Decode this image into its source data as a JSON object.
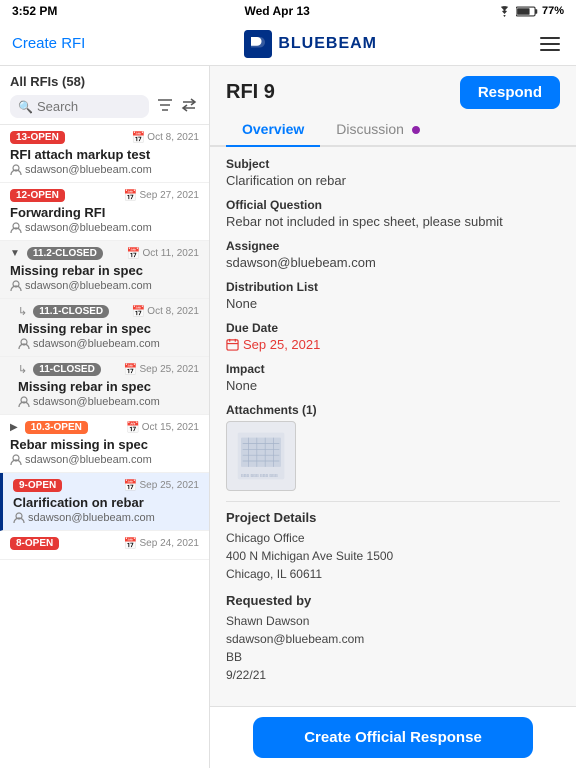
{
  "statusBar": {
    "time": "3:52 PM",
    "date": "Wed Apr 13",
    "battery": "77%",
    "wifi": true
  },
  "topNav": {
    "createRfiLabel": "Create RFI",
    "logoText": "BLUEBEAM",
    "hamburgerLabel": "Menu"
  },
  "leftPanel": {
    "allRfisLabel": "All RFIs (58)",
    "searchPlaceholder": "Search",
    "rfis": [
      {
        "id": "rfi-13",
        "badge": "13-OPEN",
        "badgeType": "open",
        "date": "Oct 8, 2021",
        "title": "RFI attach markup test",
        "user": "sdawson@bluebeam.com",
        "expanded": false,
        "selected": false,
        "childArrow": ""
      },
      {
        "id": "rfi-12",
        "badge": "12-OPEN",
        "badgeType": "open",
        "date": "Sep 27, 2021",
        "title": "Forwarding RFI",
        "user": "sdawson@bluebeam.com",
        "expanded": false,
        "selected": false,
        "childArrow": ""
      },
      {
        "id": "rfi-11-2",
        "badge": "11.2-CLOSED",
        "badgeType": "closed",
        "date": "Oct 11, 2021",
        "title": "Missing rebar in spec",
        "user": "sdawson@bluebeam.com",
        "expanded": true,
        "selected": false,
        "childArrow": "down"
      },
      {
        "id": "rfi-11-1",
        "badge": "11.1-CLOSED",
        "badgeType": "closed",
        "date": "Oct 8, 2021",
        "title": "Missing rebar in spec",
        "user": "sdawson@bluebeam.com",
        "expanded": false,
        "selected": false,
        "childArrow": "child"
      },
      {
        "id": "rfi-11",
        "badge": "11-CLOSED",
        "badgeType": "closed",
        "date": "Sep 25, 2021",
        "title": "Missing rebar in spec",
        "user": "sdawson@bluebeam.com",
        "expanded": false,
        "selected": false,
        "childArrow": "child"
      },
      {
        "id": "rfi-10-3",
        "badge": "10.3-OPEN",
        "badgeType": "open",
        "date": "Oct 15, 2021",
        "title": "Rebar missing in spec",
        "user": "sdawson@bluebeam.com",
        "expanded": false,
        "selected": false,
        "childArrow": "right"
      },
      {
        "id": "rfi-9",
        "badge": "9-OPEN",
        "badgeType": "open",
        "date": "Sep 25, 2021",
        "title": "Clarification on rebar",
        "user": "sdawson@bluebeam.com",
        "expanded": false,
        "selected": true,
        "childArrow": ""
      },
      {
        "id": "rfi-8",
        "badge": "8-OPEN",
        "badgeType": "open",
        "date": "Sep 24, 2021",
        "title": "",
        "user": "",
        "expanded": false,
        "selected": false,
        "childArrow": ""
      }
    ]
  },
  "rightPanel": {
    "rfiNumber": "RFI 9",
    "respondLabel": "Respond",
    "tabs": [
      {
        "id": "overview",
        "label": "Overview",
        "active": true,
        "dot": false
      },
      {
        "id": "discussion",
        "label": "Discussion",
        "active": false,
        "dot": true
      }
    ],
    "overview": {
      "subject": {
        "label": "Subject",
        "value": "Clarification on rebar"
      },
      "officialQuestion": {
        "label": "Official Question",
        "value": "Rebar not included in spec sheet, please submit"
      },
      "assignee": {
        "label": "Assignee",
        "value": "sdawson@bluebeam.com"
      },
      "distributionList": {
        "label": "Distribution List",
        "value": "None"
      },
      "dueDate": {
        "label": "Due Date",
        "value": "Sep 25, 2021",
        "isRed": true
      },
      "impact": {
        "label": "Impact",
        "value": "None"
      },
      "attachments": {
        "label": "Attachments (1)"
      },
      "projectDetails": {
        "label": "Project Details",
        "line1": "Chicago Office",
        "line2": "400 N Michigan Ave Suite 1500",
        "line3": "Chicago, IL 60611"
      },
      "requestedBy": {
        "label": "Requested by",
        "name": "Shawn Dawson",
        "email": "sdawson@bluebeam.com",
        "initials": "BB",
        "date": "9/22/21"
      }
    }
  },
  "bottomBar": {
    "createOfficialResponseLabel": "Create Official Response"
  }
}
